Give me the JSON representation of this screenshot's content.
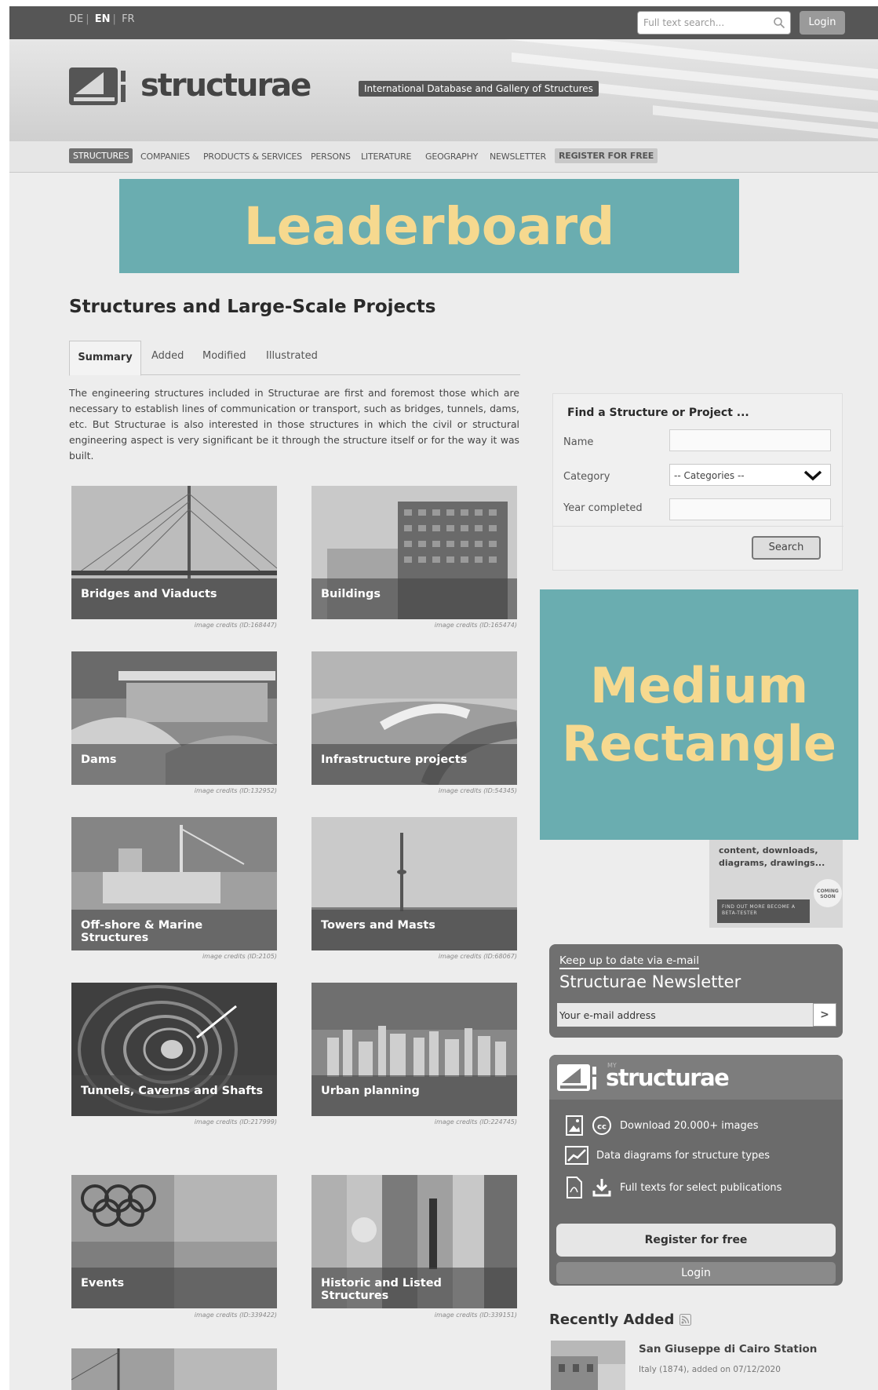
{
  "topbar": {
    "languages": [
      "DE",
      "EN",
      "FR"
    ],
    "search_placeholder": "Full text search...",
    "login_label": "Login"
  },
  "header": {
    "logo_text": "structurae",
    "tagline": "International Database and Gallery of Structures"
  },
  "nav": {
    "items": [
      "STRUCTURES",
      "COMPANIES",
      "PRODUCTS & SERVICES",
      "PERSONS",
      "LITERATURE",
      "GEOGRAPHY",
      "NEWSLETTER",
      "REGISTER FOR FREE"
    ]
  },
  "ads": {
    "leaderboard": "Leaderboard",
    "medium_rectangle_line1": "Medium",
    "medium_rectangle_line2": "Rectangle"
  },
  "main": {
    "title": "Structures and Large-Scale Projects",
    "tabs": [
      "Summary",
      "Added",
      "Modified",
      "Illustrated"
    ],
    "intro": "The engineering structures included in Structurae are first and foremost those which are necessary to establish lines of communication or transport, such as bridges, tunnels, dams, etc. But Structurae is also interested in those structures in which the civil or structural engineering aspect is very significant be it through the structure itself or for the way it was built.",
    "categories": [
      {
        "name": "Bridges and Viaducts",
        "credit": "image credits (ID:168447)"
      },
      {
        "name": "Buildings",
        "credit": "image credits (ID:165474)"
      },
      {
        "name": "Dams",
        "credit": "image credits (ID:132952)"
      },
      {
        "name": "Infrastructure projects",
        "credit": "image credits (ID:54345)"
      },
      {
        "name": "Off-shore & Marine Structures",
        "credit": "image credits (ID:2105)"
      },
      {
        "name": "Towers and Masts",
        "credit": "image credits (ID:68067)"
      },
      {
        "name": "Tunnels, Caverns and Shafts",
        "credit": "image credits (ID:217999)"
      },
      {
        "name": "Urban planning",
        "credit": "image credits (ID:224745)"
      },
      {
        "name": "Events",
        "credit": "image credits (ID:339422)"
      },
      {
        "name": "Historic and Listed Structures",
        "credit": "image credits (ID:339151)"
      }
    ]
  },
  "finder": {
    "title": "Find a Structure or Project ...",
    "name_label": "Name",
    "category_label": "Category",
    "category_value": "-- Categories --",
    "year_label": "Year completed",
    "search_label": "Search"
  },
  "promo": {
    "text": "content, downloads, diagrams, drawings...",
    "badge": "COMING SOON",
    "cta": "FIND OUT MORE BECOME A BETA-TESTER"
  },
  "newsletter": {
    "kicker": "Keep up to date via e-mail",
    "title": "Structurae Newsletter",
    "placeholder": "Your e-mail address",
    "go": ">"
  },
  "mystructurae": {
    "my": "MY",
    "logo_text": "structurae",
    "features": [
      "Download 20.000+ images",
      "Data diagrams for structure types",
      "Full texts for select publications"
    ],
    "register_label": "Register for free",
    "login_label": "Login"
  },
  "recent": {
    "title": "Recently Added",
    "item_name": "San Giuseppe di Cairo Station",
    "item_meta": "Italy (1874), added on 07/12/2020"
  },
  "colors": {
    "ad_fill": "#6aadb0",
    "ad_text": "#f6d98f",
    "topbar": "#565656"
  }
}
